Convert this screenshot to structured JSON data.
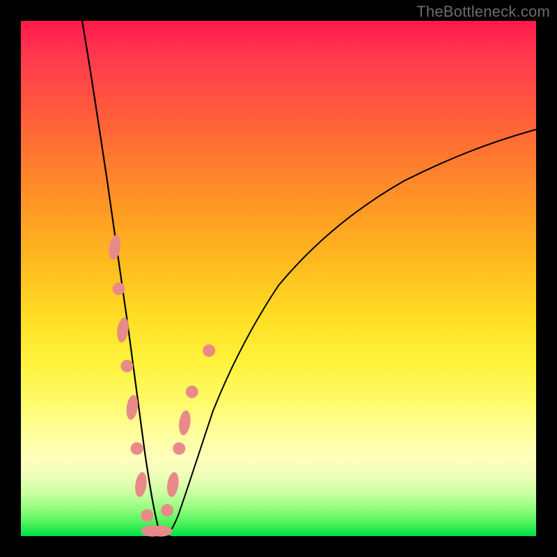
{
  "watermark": "TheBottleneck.com",
  "colors": {
    "background_frame": "#000000",
    "gradient_top": "#ff1a4d",
    "gradient_bottom": "#00e048",
    "curve": "#000000",
    "marker": "#e98a8a"
  },
  "chart_data": {
    "type": "line",
    "title": "",
    "xlabel": "",
    "ylabel": "",
    "xlim": [
      0,
      100
    ],
    "ylim": [
      0,
      100
    ],
    "grid": false,
    "legend": false,
    "description": "Bottleneck-style V-curve. Two branches descend from the top; the left branch starts near x≈12 at y=100 and the right branch ends near x=100 at y≈79. Both meet in a narrow flat trough at y≈0 around x≈24–28. Salmon-colored markers cluster along the lower left-descending and lower right-ascending segments near the trough.",
    "series": [
      {
        "name": "left-branch",
        "x": [
          12,
          13.5,
          15,
          16.5,
          18,
          19,
          20,
          21,
          22,
          23,
          24,
          25,
          26
        ],
        "y": [
          100,
          90,
          79,
          68,
          57,
          49,
          41,
          33,
          25,
          17,
          9,
          3,
          0
        ]
      },
      {
        "name": "right-branch",
        "x": [
          27,
          28,
          30,
          32,
          35,
          40,
          46,
          53,
          61,
          70,
          80,
          90,
          100
        ],
        "y": [
          0,
          3,
          10,
          18,
          28,
          40,
          49,
          57,
          64,
          70,
          74,
          77,
          79
        ]
      }
    ],
    "markers": [
      {
        "x": 18.2,
        "y": 56,
        "shape": "oval-vert"
      },
      {
        "x": 19.0,
        "y": 48,
        "shape": "round"
      },
      {
        "x": 19.8,
        "y": 40,
        "shape": "oval-vert"
      },
      {
        "x": 20.6,
        "y": 33,
        "shape": "round"
      },
      {
        "x": 21.6,
        "y": 25,
        "shape": "oval-vert"
      },
      {
        "x": 22.5,
        "y": 17,
        "shape": "round"
      },
      {
        "x": 23.3,
        "y": 10,
        "shape": "oval-vert"
      },
      {
        "x": 24.5,
        "y": 4,
        "shape": "round"
      },
      {
        "x": 25.5,
        "y": 1,
        "shape": "oval-horiz"
      },
      {
        "x": 27.2,
        "y": 1,
        "shape": "oval-horiz"
      },
      {
        "x": 28.4,
        "y": 5,
        "shape": "round"
      },
      {
        "x": 29.5,
        "y": 10,
        "shape": "oval-vert"
      },
      {
        "x": 30.7,
        "y": 17,
        "shape": "round"
      },
      {
        "x": 31.8,
        "y": 22,
        "shape": "oval-vert"
      },
      {
        "x": 33.2,
        "y": 28,
        "shape": "round"
      },
      {
        "x": 36.5,
        "y": 36,
        "shape": "round"
      }
    ]
  }
}
